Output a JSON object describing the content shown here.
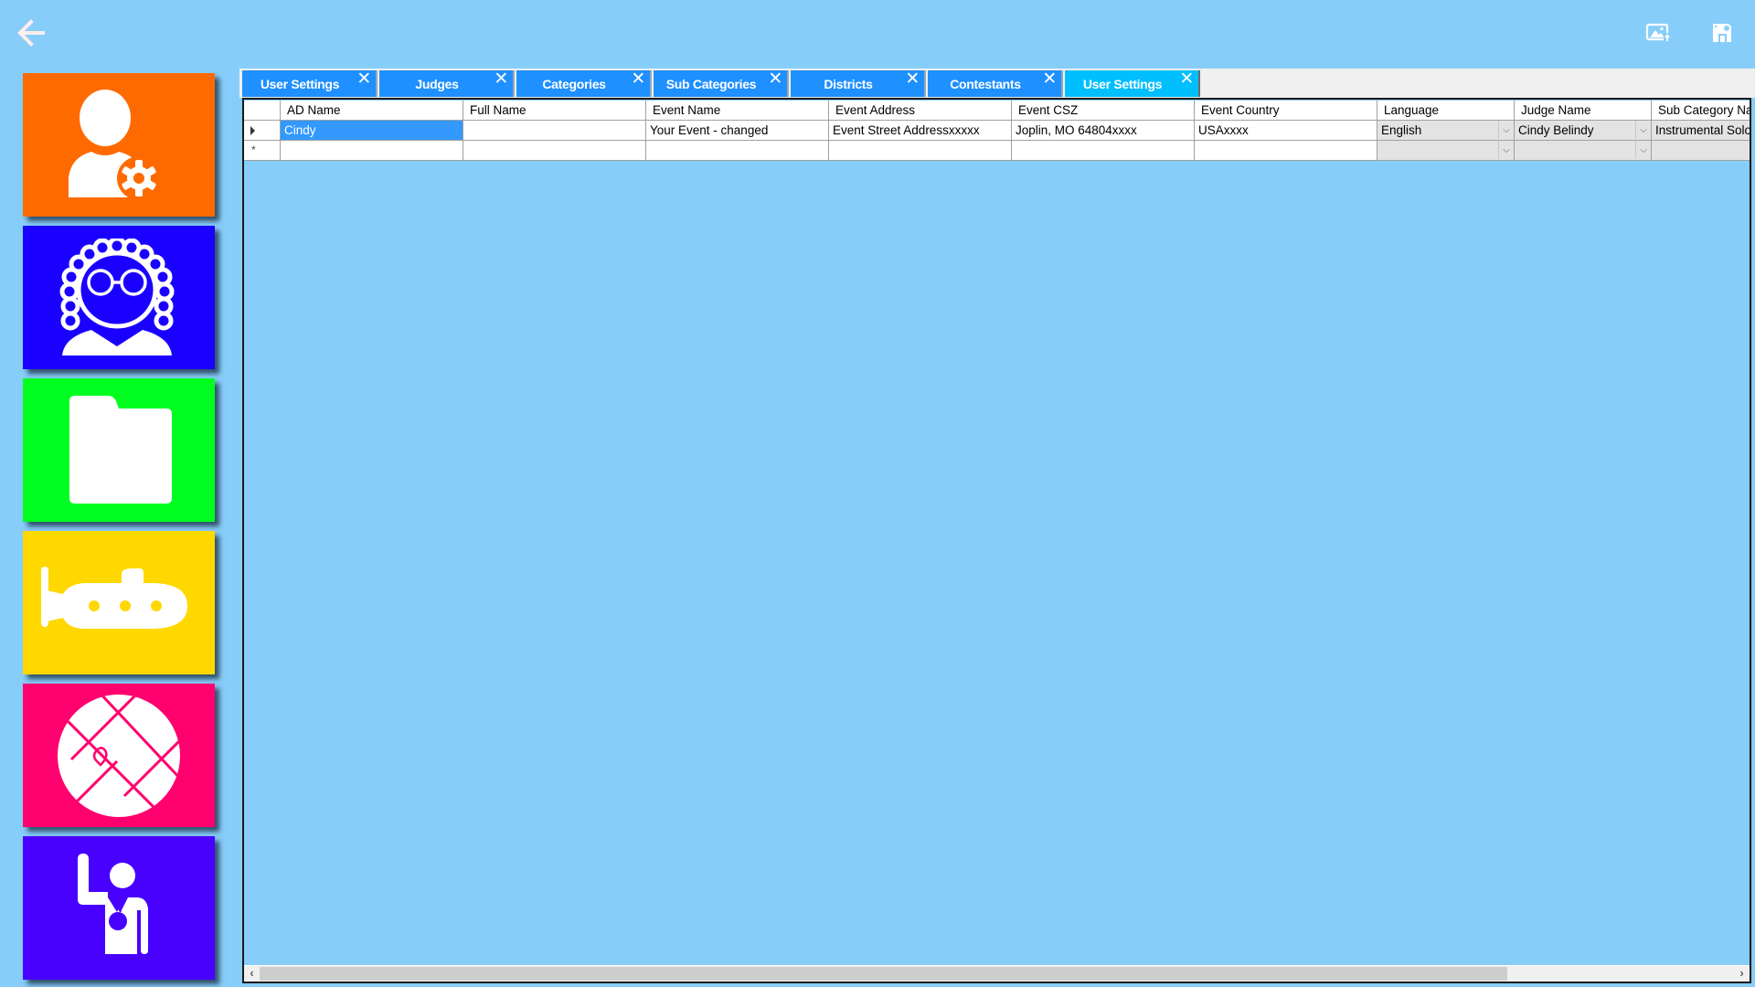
{
  "toolbar": {
    "back_icon": "arrow-left-icon",
    "image_icon": "image-export-icon",
    "save_icon": "save-floppy-icon"
  },
  "tiles": [
    {
      "name": "User Settings",
      "icon": "user-gear-icon",
      "color": "#ff6a00"
    },
    {
      "name": "Judges",
      "icon": "judge-wig-icon",
      "color": "#1a00ff"
    },
    {
      "name": "Categories",
      "icon": "folder-icon",
      "color": "#00ff21"
    },
    {
      "name": "Sub Categories",
      "icon": "submarine-icon",
      "color": "#ffd800"
    },
    {
      "name": "Districts",
      "icon": "map-icon",
      "color": "#ff006e"
    },
    {
      "name": "Contestants",
      "icon": "contestant-medal-icon",
      "color": "#4800ff"
    }
  ],
  "tabs": [
    {
      "label": "User Settings",
      "active": false
    },
    {
      "label": "Judges",
      "active": false
    },
    {
      "label": "Categories",
      "active": false
    },
    {
      "label": "Sub Categories",
      "active": false
    },
    {
      "label": "Districts",
      "active": false
    },
    {
      "label": "Contestants",
      "active": false
    },
    {
      "label": "User Settings",
      "active": true
    }
  ],
  "tab_close_glyph": "✕",
  "grid": {
    "columns": [
      "AD Name",
      "Full Name",
      "Event Name",
      "Event Address",
      "Event CSZ",
      "Event Country",
      "Language",
      "Judge Name",
      "Sub Category Na"
    ],
    "rows": [
      {
        "ad_name": "Cindy",
        "full_name": "",
        "event_name": "Your Event - changed",
        "event_address": "Event Street Addressxxxxx",
        "event_csz": "Joplin, MO  64804xxxx",
        "event_country": "USAxxxx",
        "language": "English",
        "judge_name": "Cindy Belindy",
        "sub_category": "Instrumental Solo"
      }
    ],
    "new_row_marker": "*",
    "dropdown_glyph": "⌵"
  },
  "scrollbar": {
    "left_arrow": "‹",
    "right_arrow": "›",
    "position_fraction": 0.0,
    "visible_fraction": 0.84
  },
  "colors": {
    "background": "#87cdf9",
    "tab": "#1e90ff",
    "tab_active": "#00bfff",
    "selection": "#3399ff"
  }
}
